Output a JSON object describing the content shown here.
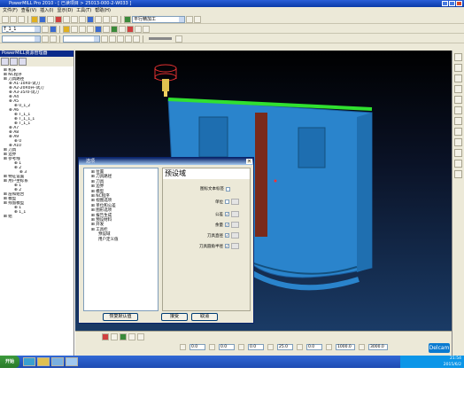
{
  "window": {
    "title": "PowerMILL Pro 2010  - [ 已读项目 > 25013-000-2-W033 ]"
  },
  "menu": [
    "文件(F)",
    "查看(V)",
    "插入(I)",
    "显示(D)",
    "工具(T)",
    "帮助(H)"
  ],
  "toolbar": {
    "combo1": "平行精加工",
    "combo2": "T_1_1",
    "combo3": ""
  },
  "explorer": {
    "title": "PowerMILL资源管理器",
    "items": [
      {
        "label": "机床",
        "level": 0
      },
      {
        "label": "NC程序",
        "level": 0
      },
      {
        "label": "刀具路径",
        "level": 0
      },
      {
        "label": "A1-10R0-试刀",
        "level": 1
      },
      {
        "label": "A2-20R0升-试刀",
        "level": 1
      },
      {
        "label": "A3-35r0-试刀",
        "level": 1
      },
      {
        "label": "A4",
        "level": 1
      },
      {
        "label": "A5",
        "level": 1
      },
      {
        "label": "0_1_2",
        "level": 2
      },
      {
        "label": "A6",
        "level": 1
      },
      {
        "label": "T_1_1",
        "level": 2
      },
      {
        "label": "T_1_1_1",
        "level": 2
      },
      {
        "label": "T_1_1",
        "level": 2
      },
      {
        "label": "A7",
        "level": 1
      },
      {
        "label": "A8",
        "level": 1
      },
      {
        "label": "A9",
        "level": 1
      },
      {
        "label": "0",
        "level": 2
      },
      {
        "label": "A10",
        "level": 1
      },
      {
        "label": "刀具",
        "level": 0
      },
      {
        "label": "边界",
        "level": 0
      },
      {
        "label": "参考线",
        "level": 0
      },
      {
        "label": "1",
        "level": 2
      },
      {
        "label": "2",
        "level": 2
      },
      {
        "label": "3",
        "level": 3
      },
      {
        "label": "特征设置",
        "level": 0
      },
      {
        "label": "用户坐标系",
        "level": 0
      },
      {
        "label": "1",
        "level": 2
      },
      {
        "label": "2",
        "level": 2
      },
      {
        "label": "层和组合",
        "level": 0
      },
      {
        "label": "模型",
        "level": 0
      },
      {
        "label": "残留模型",
        "level": 0
      },
      {
        "label": "1",
        "level": 2
      },
      {
        "label": "1_1",
        "level": 2
      },
      {
        "label": "组",
        "level": 0
      }
    ]
  },
  "dialog": {
    "title": "选项",
    "close": "×",
    "tree": [
      {
        "label": "位置",
        "level": 0
      },
      {
        "label": "刀具路径",
        "level": 0
      },
      {
        "label": "刀具",
        "level": 0
      },
      {
        "label": "边界",
        "level": 0
      },
      {
        "label": "模型",
        "level": 0
      },
      {
        "label": "NC程序",
        "level": 0
      },
      {
        "label": "视图选项",
        "level": 0
      },
      {
        "label": "单位和公差",
        "level": 0
      },
      {
        "label": "图形选项",
        "level": 0
      },
      {
        "label": "报告生成",
        "level": 0
      },
      {
        "label": "预设材料",
        "level": 0
      },
      {
        "label": "开发",
        "level": 0
      },
      {
        "label": "工具栏",
        "level": 0
      },
      {
        "label": "预设域",
        "level": 1
      },
      {
        "label": "用户定义值",
        "level": 1
      }
    ],
    "panel_head": "预设域",
    "options": [
      {
        "label": "图标文本标签",
        "checked": false
      },
      {
        "label": "单位",
        "checked": false
      },
      {
        "label": "公差",
        "checked": true
      },
      {
        "label": "余量",
        "checked": true
      },
      {
        "label": "刀具直径",
        "checked": true
      },
      {
        "label": "刀具圆角半径",
        "checked": true
      }
    ],
    "reset": "恢复默认值",
    "accept": "接受",
    "cancel": "取消"
  },
  "bottom": {
    "fields": [
      "0.0",
      "0.0",
      "0.0",
      "25.0",
      "0.0",
      "1000.0",
      "3000.0"
    ]
  },
  "brand": "Delcam",
  "taskbar": {
    "start": "开始",
    "time": "21:54",
    "date": "2015/6/2"
  }
}
